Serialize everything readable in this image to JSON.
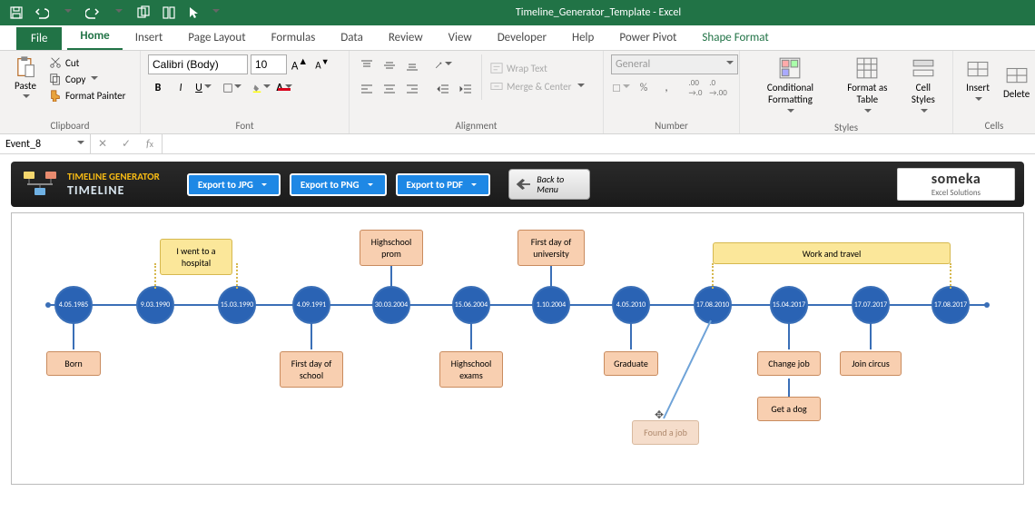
{
  "titlebar": {
    "doc_title": "Timeline_Generator_Template - Excel"
  },
  "tabs": {
    "file": "File",
    "home": "Home",
    "insert": "Insert",
    "pagelayout": "Page Layout",
    "formulas": "Formulas",
    "data": "Data",
    "review": "Review",
    "view": "View",
    "developer": "Developer",
    "help": "Help",
    "powerpivot": "Power Pivot",
    "shapeformat": "Shape Format"
  },
  "ribbon": {
    "paste": "Paste",
    "cut": "Cut",
    "copy": "Copy",
    "format_painter": "Format Painter",
    "clipboard": "Clipboard",
    "font_name": "Calibri (Body)",
    "font_size": "10",
    "font": "Font",
    "wrap_text": "Wrap Text",
    "merge_center": "Merge & Center",
    "alignment": "Alignment",
    "number_format": "General",
    "number": "Number",
    "cond_format": "Conditional Formatting",
    "format_table": "Format as Table",
    "cell_styles": "Cell Styles",
    "styles": "Styles",
    "insert": "Insert",
    "delete": "Delete",
    "cells": "Cells"
  },
  "formula_bar": {
    "name_box": "Event_8"
  },
  "app": {
    "title_top": "TIMELINE GENERATOR",
    "title_bottom": "TIMELINE",
    "export_jpg": "Export to JPG",
    "export_png": "Export to PNG",
    "export_pdf": "Export to PDF",
    "back_menu": "Back to Menu",
    "brand_top": "someka",
    "brand_bot": "Excel Solutions"
  },
  "timeline": {
    "nodes": [
      {
        "date": "4.05.1985"
      },
      {
        "date": "9.03.1990"
      },
      {
        "date": "15.03.1990"
      },
      {
        "date": "4.09.1991"
      },
      {
        "date": "30.03.2004"
      },
      {
        "date": "15.06.2004"
      },
      {
        "date": "1.10.2004"
      },
      {
        "date": "4.05.2010"
      },
      {
        "date": "17.08.2010"
      },
      {
        "date": "15.04.2017"
      },
      {
        "date": "17.07.2017"
      },
      {
        "date": "17.08.2017"
      }
    ],
    "labels": {
      "born": "Born",
      "hospital": "I went to a hospital",
      "first_school": "First day of school",
      "prom": "Highschool prom",
      "exams": "Highschool exams",
      "first_uni": "First day of university",
      "graduate": "Graduate",
      "found_job": "Found a job",
      "change_job": "Change job",
      "get_dog": "Get a dog",
      "join_circus": "Join circus",
      "work_travel": "Work and travel"
    }
  }
}
